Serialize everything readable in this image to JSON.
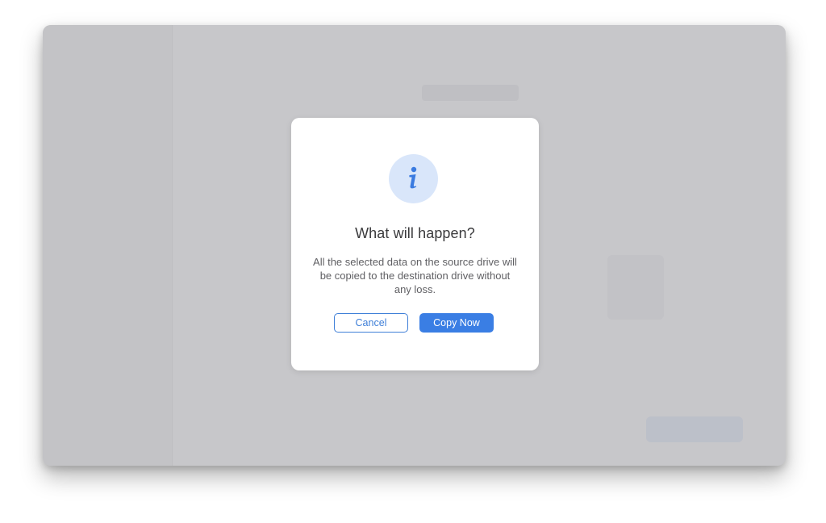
{
  "dialog": {
    "title": "What will happen?",
    "message": "All the selected data on the source drive will be copied to the destination drive without any loss.",
    "icon": "info-icon",
    "cancel_label": "Cancel",
    "confirm_label": "Copy Now"
  },
  "colors": {
    "accent": "#3a7ee4",
    "icon_bg": "#d9e6fa",
    "overlay": "#c7c7ca"
  }
}
